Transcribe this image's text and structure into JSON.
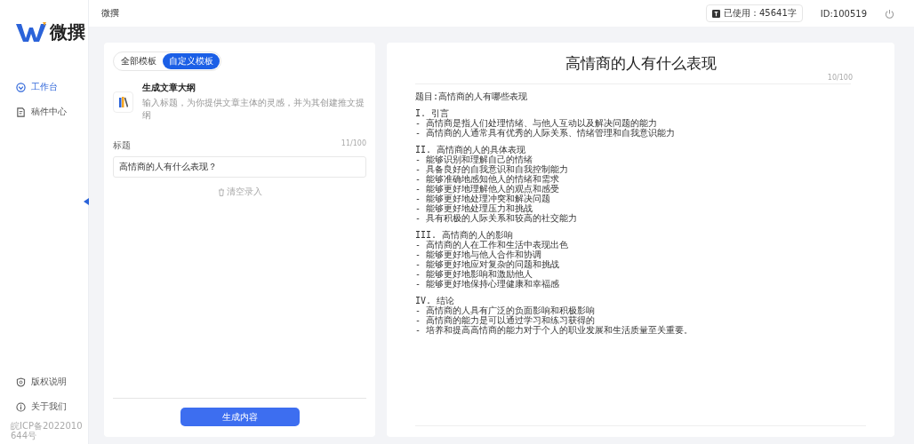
{
  "brand": {
    "name": "微撰"
  },
  "header": {
    "title": "微撰",
    "usage": "已使用：45641字",
    "user_id": "ID:100519"
  },
  "nav": [
    {
      "label": "工作台",
      "kind": "dashboard",
      "selected": true
    },
    {
      "label": "稿件中心",
      "kind": "document",
      "selected": false
    }
  ],
  "footer_nav": [
    {
      "label": "版权说明",
      "kind": "shield"
    },
    {
      "label": "关于我们",
      "kind": "info"
    }
  ],
  "icp": "皖ICP备2022010644号",
  "tabs": [
    {
      "label": "全部模板",
      "selected": false
    },
    {
      "label": "自定义模板",
      "selected": true
    }
  ],
  "template": {
    "title": "生成文章大纲",
    "description": "输入标题，为你提供文章主体的灵感，并为其创建推文提纲"
  },
  "field": {
    "label": "标题",
    "counter": "11/100",
    "value": "高情商的人有什么表现？"
  },
  "clear_button": "清空录入",
  "generate_button": "生成内容",
  "document": {
    "title": "高情商的人有什么表现",
    "counter": "10/100",
    "topic": "题目:高情商的人有哪些表现",
    "sections": [
      {
        "heading": "I. 引言",
        "items": [
          "- 高情商是指人们处理情绪、与他人互动以及解决问题的能力",
          "- 高情商的人通常具有优秀的人际关系、情绪管理和自我意识能力"
        ]
      },
      {
        "heading": "II. 高情商的人的具体表现",
        "items": [
          "- 能够识别和理解自己的情绪",
          "- 具备良好的自我意识和自我控制能力",
          "- 能够准确地感知他人的情绪和需求",
          "- 能够更好地理解他人的观点和感受",
          "- 能够更好地处理冲突和解决问题",
          "- 能够更好地处理压力和挑战",
          "- 具有积极的人际关系和较高的社交能力"
        ]
      },
      {
        "heading": "III. 高情商的人的影响",
        "items": [
          "- 高情商的人在工作和生活中表现出色",
          "- 能够更好地与他人合作和协调",
          "- 能够更好地应对复杂的问题和挑战",
          "- 能够更好地影响和激励他人",
          "- 能够更好地保持心理健康和幸福感"
        ]
      },
      {
        "heading": "IV. 结论",
        "items": [
          "- 高情商的人具有广泛的负面影响和积极影响",
          "- 高情商的能力是可以通过学习和练习获得的",
          "- 培养和提高高情商的能力对于个人的职业发展和生活质量至关重要。"
        ]
      }
    ]
  }
}
